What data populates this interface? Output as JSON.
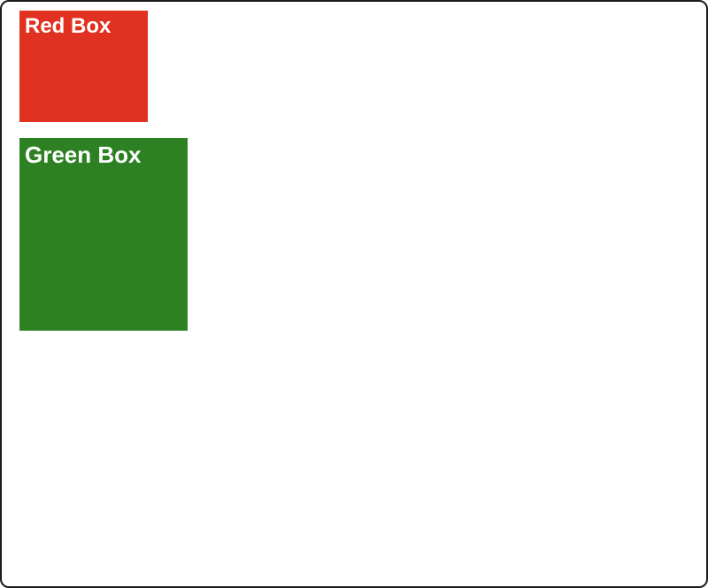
{
  "boxes": {
    "red": {
      "label": "Red Box",
      "color": "#e13120"
    },
    "green": {
      "label": "Green Box",
      "color": "#2d8123"
    }
  }
}
